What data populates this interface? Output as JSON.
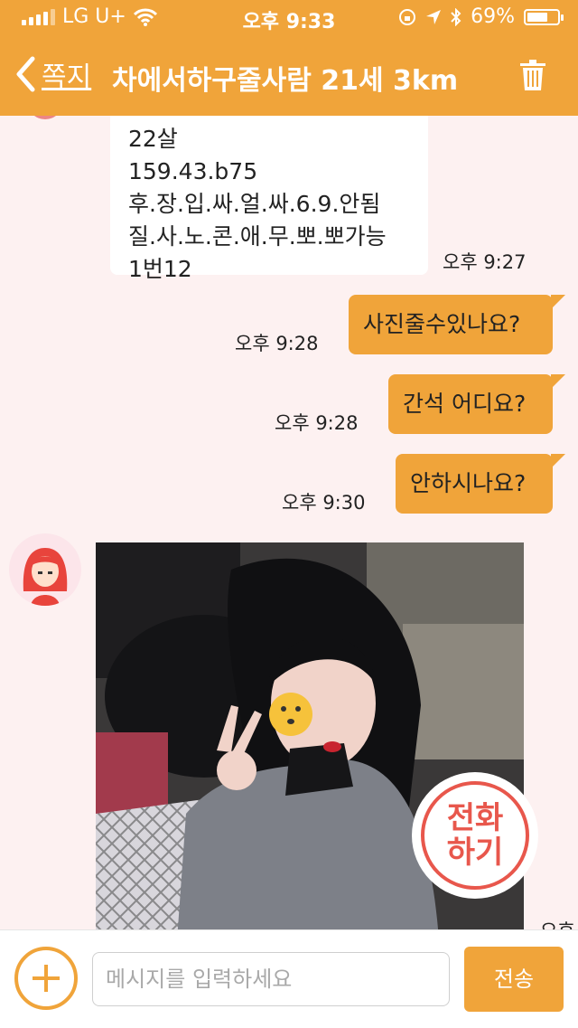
{
  "status_bar": {
    "carrier": "LG U+",
    "time": "오후 9:33",
    "battery": "69%",
    "battery_level": 0.69
  },
  "header": {
    "back_label": "쪽지",
    "title": "차에서하구줄사람 21세 3km"
  },
  "messages": {
    "incoming_text": {
      "lines": [
        "22살",
        "159.43.b75",
        "후.장.입.싸.얼.싸.6.9.안됨",
        "질.사.노.콘.애.무.뽀.뽀가능",
        "1번12"
      ],
      "time": "오후 9:27"
    },
    "outgoing": [
      {
        "text": "사진줄수있나요?",
        "time": "오후 9:28"
      },
      {
        "text": "간석 어디요?",
        "time": "오후 9:28"
      },
      {
        "text": "안하시나요?",
        "time": "오후 9:30"
      }
    ],
    "photo_time_partial": "오후"
  },
  "call_button": {
    "line1": "전화",
    "line2": "하기"
  },
  "composer": {
    "placeholder": "메시지를 입력하세요",
    "value": "",
    "send_label": "전송"
  },
  "colors": {
    "accent": "#f0a43a",
    "background": "#fdf1f1",
    "call_red": "#e8574c"
  },
  "icons": [
    "signal-icon",
    "wifi-icon",
    "location-icon",
    "bluetooth-icon",
    "battery-icon",
    "back-chevron-icon",
    "trash-icon",
    "plus-icon"
  ]
}
